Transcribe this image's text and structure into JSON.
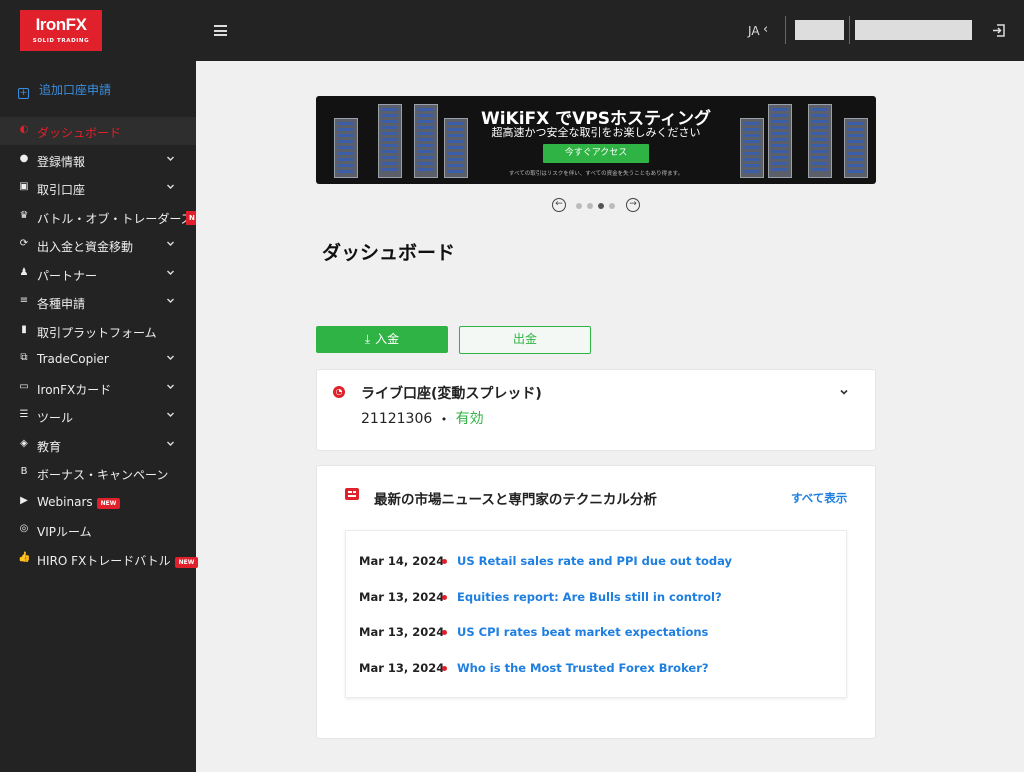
{
  "brand": {
    "name": "IronFX",
    "tagline": "SOLID TRADING"
  },
  "header": {
    "language": "JA",
    "language_arrow": "‹"
  },
  "sidebar": {
    "add_account": "追加口座申請",
    "items": [
      {
        "label": "ダッシュボード",
        "icon": "dashboard-icon",
        "glyph": "◐",
        "chevron": false,
        "active": true
      },
      {
        "label": "登録情報",
        "icon": "user-icon",
        "glyph": "●",
        "chevron": true
      },
      {
        "label": "取引口座",
        "icon": "account-icon",
        "glyph": "▣",
        "chevron": true
      },
      {
        "label": "バトル・オブ・トレーダーズ",
        "icon": "crown-icon",
        "glyph": "♛",
        "chevron": false,
        "badge": "N"
      },
      {
        "label": "出入金と資金移動",
        "icon": "transfer-icon",
        "glyph": "⟳",
        "chevron": true
      },
      {
        "label": "パートナー",
        "icon": "partner-icon",
        "glyph": "♟",
        "chevron": true
      },
      {
        "label": "各種申請",
        "icon": "list-icon",
        "glyph": "≡",
        "chevron": true
      },
      {
        "label": "取引プラットフォーム",
        "icon": "bar-chart-icon",
        "glyph": "▮",
        "chevron": false
      },
      {
        "label": "TradeCopier",
        "icon": "copy-icon",
        "glyph": "⧉",
        "chevron": true
      },
      {
        "label": "IronFXカード",
        "icon": "card-icon",
        "glyph": "▭",
        "chevron": true
      },
      {
        "label": "ツール",
        "icon": "tools-icon",
        "glyph": "☰",
        "chevron": true
      },
      {
        "label": "教育",
        "icon": "education-icon",
        "glyph": "◈",
        "chevron": true
      },
      {
        "label": "ボーナス・キャンペーン",
        "icon": "bitcoin-icon",
        "glyph": "B",
        "chevron": false
      },
      {
        "label": "Webinars",
        "icon": "play-icon",
        "glyph": "▶",
        "chevron": false,
        "badge": "NEW"
      },
      {
        "label": "VIPルーム",
        "icon": "vip-icon",
        "glyph": "◎",
        "chevron": false
      },
      {
        "label": "HIRO FXトレードバトル",
        "icon": "thumbs-up-icon",
        "glyph": "👍",
        "chevron": false,
        "badge": "NEW"
      }
    ]
  },
  "banner": {
    "title": "WiKiFX でVPSホスティング",
    "subtitle": "超高速かつ安全な取引をお楽しみください",
    "button": "今すぐアクセス",
    "note": "すべての取引はリスクを伴い、すべての資金を失うこともあり得ます。"
  },
  "carousel": {
    "prev": "←",
    "next": "→",
    "dots": 4,
    "active_index": 2
  },
  "page_title": "ダッシュボード",
  "actions": {
    "deposit": "入金",
    "deposit_icon": "⤓",
    "withdraw": "出金"
  },
  "account": {
    "name": "ライブ口座(変動スプレッド)",
    "number": "21121306",
    "separator": "•",
    "status": "有効"
  },
  "news": {
    "title": "最新の市場ニュースと専門家のテクニカル分析",
    "view_all": "すべて表示",
    "items": [
      {
        "date": "Mar 14, 2024",
        "title": "US Retail sales rate and PPI due out today"
      },
      {
        "date": "Mar 13, 2024",
        "title": "Equities report: Are Bulls still in control?"
      },
      {
        "date": "Mar 13, 2024",
        "title": "US CPI rates beat market expectations"
      },
      {
        "date": "Mar 13, 2024",
        "title": "Who is the Most Trusted Forex Broker?"
      }
    ]
  }
}
